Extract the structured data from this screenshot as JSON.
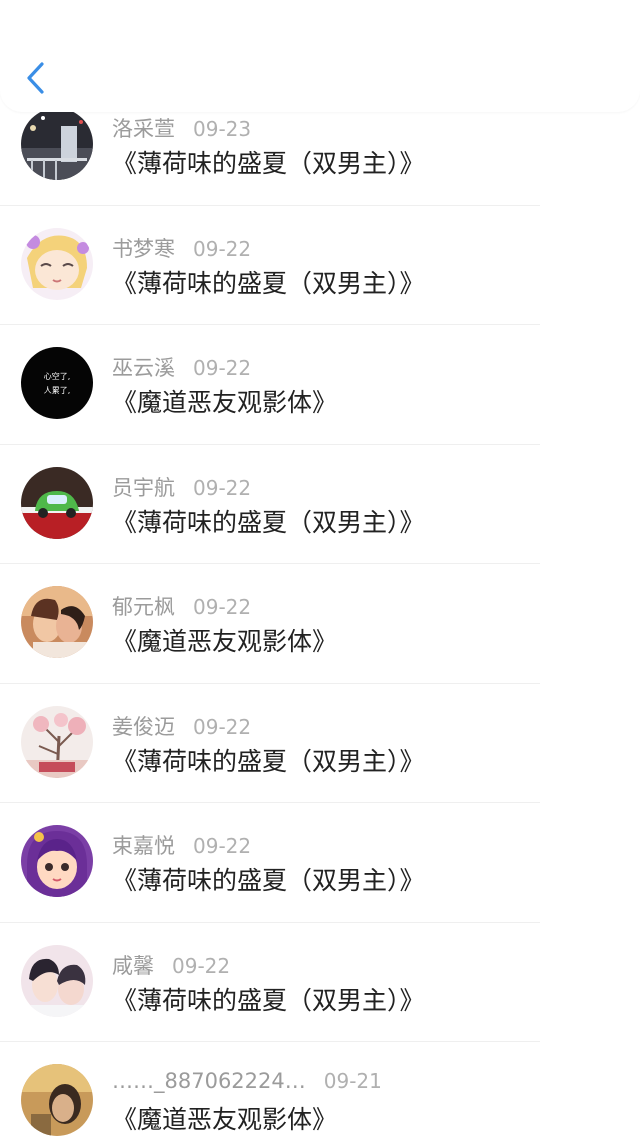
{
  "header": {
    "back_icon": "chevron-left-icon",
    "accent": "#3a8ee6"
  },
  "messages": [
    {
      "name": "洛采萱",
      "date": "09-23",
      "title": "《薄荷味的盛夏（双男主）》",
      "avatar": "night-scene"
    },
    {
      "name": "书梦寒",
      "date": "09-22",
      "title": "《薄荷味的盛夏（双男主）》",
      "avatar": "anime-girl"
    },
    {
      "name": "巫云溪",
      "date": "09-22",
      "title": "《魔道恶友观影体》",
      "avatar": "black-text",
      "avatar_text": [
        "心空了,",
        "人累了,"
      ]
    },
    {
      "name": "员宇航",
      "date": "09-22",
      "title": "《薄荷味的盛夏（双男主）》",
      "avatar": "green-car"
    },
    {
      "name": "郁元枫",
      "date": "09-22",
      "title": "《魔道恶友观影体》",
      "avatar": "couple-photo"
    },
    {
      "name": "姜俊迈",
      "date": "09-22",
      "title": "《薄荷味的盛夏（双男主）》",
      "avatar": "pink-tree"
    },
    {
      "name": "束嘉悦",
      "date": "09-22",
      "title": "《薄荷味的盛夏（双男主）》",
      "avatar": "cartoon-girl"
    },
    {
      "name": "咸馨",
      "date": "09-22",
      "title": "《薄荷味的盛夏（双男主）》",
      "avatar": "anime-boys"
    },
    {
      "name": "……_887062224…",
      "date": "09-21",
      "title": "《魔道恶友观影体》",
      "avatar": "portrait"
    }
  ]
}
